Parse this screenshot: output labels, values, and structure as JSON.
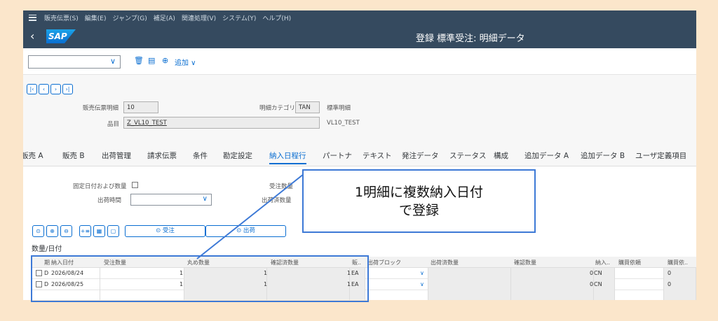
{
  "menu": [
    "販売伝票(S)",
    "編集(E)",
    "ジャンプ(G)",
    "補足(A)",
    "関連処理(V)",
    "システム(Y)",
    "ヘルプ(H)"
  ],
  "title": "登録 標準受注: 明細データ",
  "logo": "SAP",
  "toolbar": {
    "add_label": "追加 ∨"
  },
  "header": {
    "item_label": "販売伝票明細",
    "item_value": "10",
    "category_label": "明細カテゴリ",
    "category_value": "TAN",
    "category_text": "標準明細",
    "material_label": "品目",
    "material_value": "Z_VL10_TEST",
    "material_text": "VL10_TEST"
  },
  "tabs": [
    "販売 A",
    "販売 B",
    "出荷管理",
    "請求伝票",
    "条件",
    "勘定設定",
    "納入日程行",
    "パートナ",
    "テキスト",
    "発注データ",
    "ステータス",
    "構成",
    "追加データ A",
    "追加データ B",
    "ユーザ定義項目"
  ],
  "selected_tab": "納入日程行",
  "form": {
    "fixed_label": "固定日付および数量",
    "shiptime_label": "出荷時間",
    "order_qty_label": "受注数量",
    "shipped_qty_label": "出荷済数量"
  },
  "buttons": {
    "order": "受注",
    "ship": "出荷"
  },
  "section_title": "数量/日付",
  "table": {
    "headers": [
      "期",
      "納入日付",
      "受注数量",
      "丸め数量",
      "確認済数量",
      "販..",
      "出荷ブロック",
      "出荷済数量",
      "確認数量",
      "納入..",
      "購買依頼",
      "購買依.."
    ],
    "rows": [
      {
        "type": "D",
        "date": "2026/08/24",
        "order_qty": "1",
        "round_qty": "1",
        "confirmed_qty": "1",
        "unit": "EA",
        "block": "",
        "shipped": "",
        "confirm": "0",
        "deliv": "CN",
        "pr": "",
        "pr2": "0"
      },
      {
        "type": "D",
        "date": "2026/08/25",
        "order_qty": "1",
        "round_qty": "1",
        "confirmed_qty": "1",
        "unit": "EA",
        "block": "",
        "shipped": "",
        "confirm": "0",
        "deliv": "CN",
        "pr": "",
        "pr2": "0"
      }
    ]
  },
  "callout": {
    "line1": "1明細に複数納入日付",
    "line2": "で登録"
  },
  "colors": {
    "shell": "#354a5f",
    "accent": "#0a6ed1",
    "highlight": "#3d79d6",
    "background": "#fbe6cb"
  }
}
